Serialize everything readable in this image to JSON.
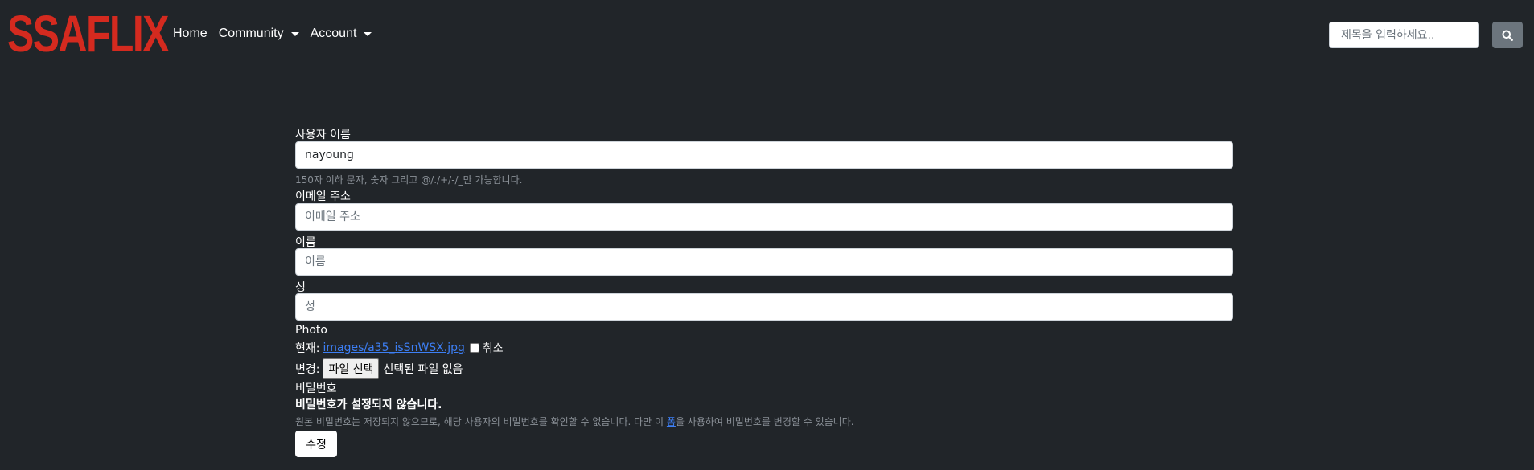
{
  "nav": {
    "brand": "SSAFLIX",
    "links": [
      {
        "label": "Home",
        "dropdown": false
      },
      {
        "label": "Community",
        "dropdown": true
      },
      {
        "label": "Account",
        "dropdown": true
      }
    ],
    "search": {
      "placeholder": "제목을 입력하세요..",
      "value": "",
      "icon": "search-icon"
    }
  },
  "form": {
    "username": {
      "label": "사용자 이름",
      "value": "nayoung",
      "help": "150자 이하 문자, 숫자 그리고 @/./+/-/_만 가능합니다."
    },
    "email": {
      "label": "이메일 주소",
      "placeholder": "이메일 주소",
      "value": ""
    },
    "first_name": {
      "label": "이름",
      "placeholder": "이름",
      "value": ""
    },
    "last_name": {
      "label": "성",
      "placeholder": "성",
      "value": ""
    },
    "photo": {
      "label": "Photo",
      "current_label": "현재:",
      "current_file": "images/a35_isSnWSX.jpg",
      "clear_label": "취소",
      "clear_checked": false,
      "change_label": "변경:",
      "choose_button": "파일 선택",
      "no_file_text": "선택된 파일 없음"
    },
    "password": {
      "label": "비밀번호",
      "status": "비밀번호가 설정되지 않습니다.",
      "help_before": "원본 비밀번호는 저장되지 않으므로, 해당 사용자의 비밀번호를 확인할 수 없습니다. 다만 이 ",
      "help_link": "폼",
      "help_after": "을 사용하여 비밀번호를 변경할 수 있습니다."
    },
    "submit_label": "수정"
  },
  "colors": {
    "background": "#212529",
    "brand": "#d42a1f",
    "link": "#3d7ff5",
    "search_button": "#6c757d",
    "help_text": "#8a9097"
  }
}
